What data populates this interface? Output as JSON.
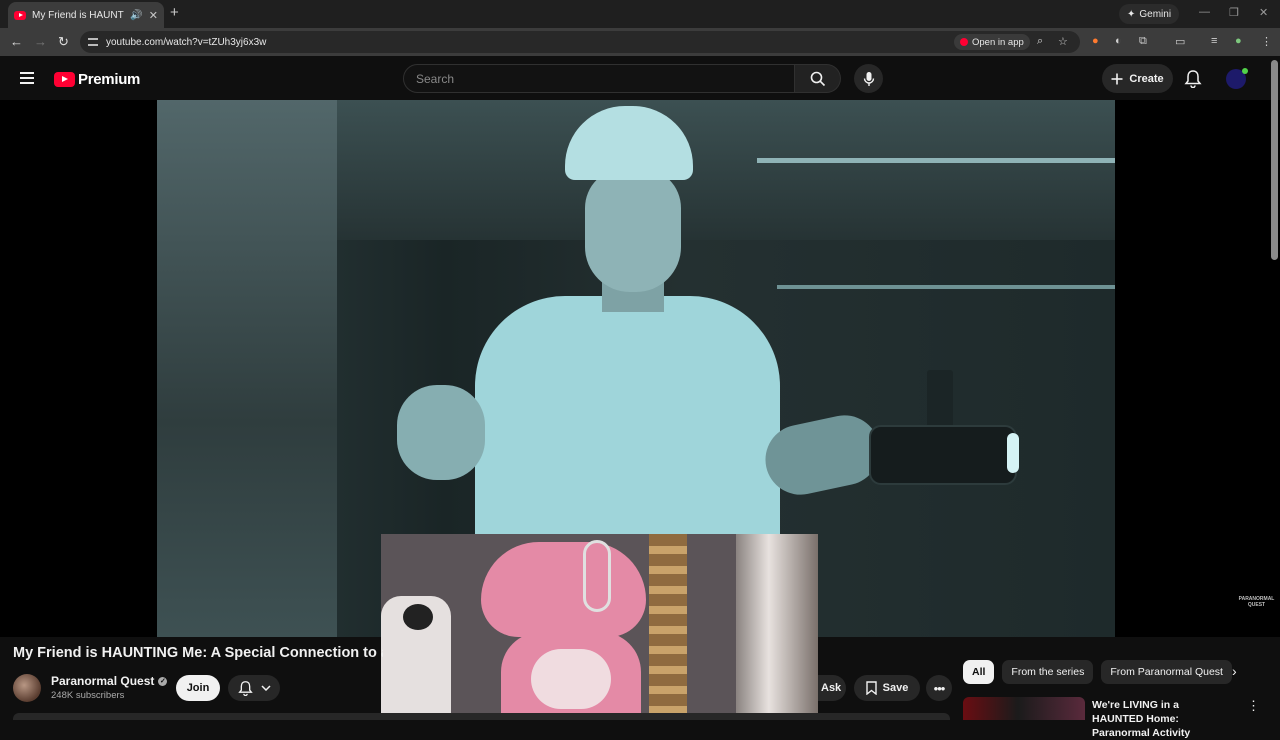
{
  "browser": {
    "tab_title": "My Friend is HAUNTING Me: A Special Connection to a Ghost",
    "url": "youtube.com/watch?v=tZUh3yj6x3w",
    "gemini_label": "Gemini",
    "open_in_app_label": "Open in app"
  },
  "masthead": {
    "logo_text": "Premium",
    "search_placeholder": "Search",
    "create_label": "Create"
  },
  "player": {
    "watermark": "PARANORMAL QUEST"
  },
  "video": {
    "title": "My Friend is HAUNTING Me: A Special Connection to a Ghost",
    "channel_name": "Paranormal Quest",
    "subscribers": "248K subscribers",
    "join_label": "Join",
    "ask_label": "Ask",
    "save_label": "Save"
  },
  "sidebar": {
    "chips": [
      "All",
      "From the series",
      "From Paranormal Quest"
    ],
    "recommendation_title": "We're LIVING in a HAUNTED Home: Paranormal Activity"
  },
  "colors": {
    "background": "#0f0f0f",
    "brand_red": "#ff0033",
    "chip_bg": "#272727"
  }
}
